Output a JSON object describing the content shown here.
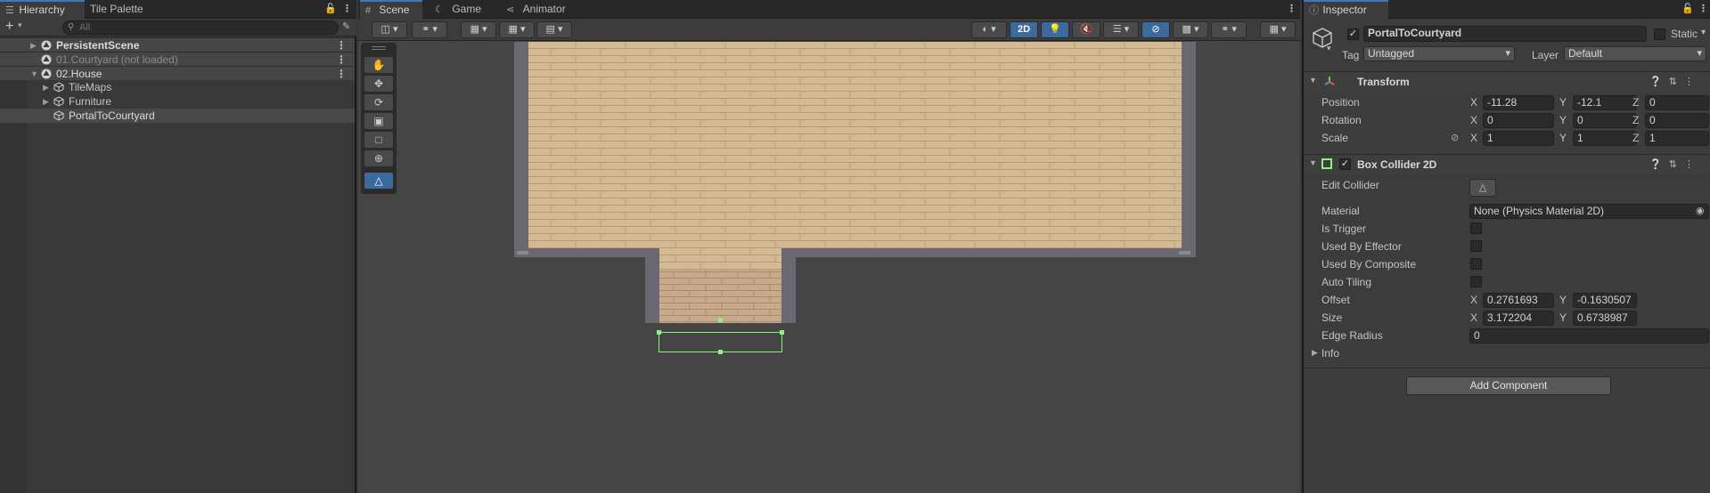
{
  "hierarchy": {
    "tab_label": "Hierarchy",
    "tab2_label": "Tile Palette",
    "add_label": "+",
    "search_placeholder": "All",
    "rows": [
      {
        "label": "PersistentScene"
      },
      {
        "label": "01.Courtyard (not loaded)"
      },
      {
        "label": "02.House"
      },
      {
        "label": "TileMaps"
      },
      {
        "label": "Furniture"
      },
      {
        "label": "PortalToCourtyard"
      }
    ]
  },
  "scene": {
    "tabs": [
      {
        "label": "Scene"
      },
      {
        "label": "Game"
      },
      {
        "label": "Animator"
      }
    ],
    "toolbar": {
      "mode_2d": "2D"
    },
    "colors": {
      "floor": "#d4b995",
      "brick_line": "#b89b76",
      "wall": "#6b6872",
      "wall_edge": "#4c4a52",
      "collider": "#8ef27f"
    }
  },
  "inspector": {
    "tab_label": "Inspector",
    "object_name": "PortalToCourtyard",
    "static_label": "Static",
    "tag_label": "Tag",
    "tag_value": "Untagged",
    "layer_label": "Layer",
    "layer_value": "Default",
    "transform": {
      "title": "Transform",
      "position_label": "Position",
      "rotation_label": "Rotation",
      "scale_label": "Scale",
      "axis_x": "X",
      "axis_y": "Y",
      "axis_z": "Z",
      "position": {
        "x": "-11.28",
        "y": "-12.1",
        "z": "0"
      },
      "rotation": {
        "x": "0",
        "y": "0",
        "z": "0"
      },
      "scale": {
        "x": "1",
        "y": "1",
        "z": "1"
      }
    },
    "box_collider": {
      "title": "Box Collider 2D",
      "edit_collider_label": "Edit Collider",
      "material_label": "Material",
      "material_value": "None (Physics Material 2D)",
      "is_trigger_label": "Is Trigger",
      "used_by_effector_label": "Used By Effector",
      "used_by_composite_label": "Used By Composite",
      "auto_tiling_label": "Auto Tiling",
      "offset_label": "Offset",
      "offset": {
        "x": "0.2761693",
        "y": "-0.1630507"
      },
      "size_label": "Size",
      "size": {
        "x": "3.172204",
        "y": "0.6738987"
      },
      "edge_radius_label": "Edge Radius",
      "edge_radius_value": "0",
      "info_label": "Info"
    },
    "add_component_label": "Add Component"
  }
}
